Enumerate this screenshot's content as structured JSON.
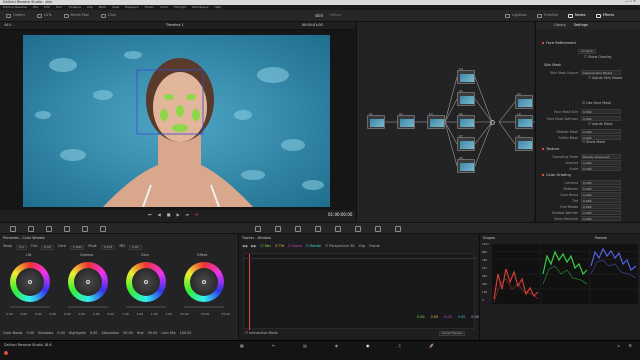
{
  "window": {
    "title": "DaVinci Resolve Studio - skin"
  },
  "menu": [
    "DaVinci Resolve",
    "File",
    "Edit",
    "Trim",
    "Timeline",
    "Clip",
    "Mark",
    "View",
    "Playback",
    "Fusion",
    "Color",
    "Fairlight",
    "Workspace",
    "Help"
  ],
  "topbar": {
    "left_buttons": [
      "Gallery",
      "LUTs",
      "Media Pool",
      "Clips"
    ],
    "project": "skin",
    "edited": "Edited",
    "right_buttons": [
      "Lightbox",
      "Timeline",
      "Nodes",
      "Effects",
      "Lightbox"
    ]
  },
  "viewerbar": {
    "zoom": "46%",
    "timeline": "Timeline 1",
    "timecode": "00:00:01:00",
    "clip_mode": "Clip"
  },
  "transport": {
    "timecode": "01:00:00:00"
  },
  "nodes": {
    "labels": [
      "01",
      "02",
      "03",
      "04",
      "05",
      "06",
      "07",
      "08",
      "09",
      "10",
      "11"
    ]
  },
  "inspector": {
    "tabs": [
      "Library",
      "Settings"
    ],
    "plugin": "Face Refinement",
    "analyze": "Analyze",
    "show_overlay": "Show Overlay",
    "skin_mask_title": "Skin Mask",
    "mask_source_label": "Skin Mask Source",
    "mask_source_value": "Internal Skin Model",
    "adjust_skin_model": "Adjust Skin Model",
    "use_face_mask": "Use Face Mask",
    "adjust_mask": "Adjust Mask",
    "show_mask": "Show Mask",
    "rows1": [
      {
        "label": "Face Mask Size",
        "value": "0.000"
      },
      {
        "label": "Face Mask Softness",
        "value": "0.000"
      }
    ],
    "rows2": [
      {
        "label": "Feather Mask",
        "value": "0.000"
      },
      {
        "label": "Soften Mask",
        "value": "0.000"
      }
    ],
    "texture_title": "Texture",
    "texture_rows": [
      {
        "label": "Operating Mode",
        "value": "Beauty Advanced"
      },
      {
        "label": "Amount",
        "value": "0.000"
      },
      {
        "label": "Scale",
        "value": "0.000"
      }
    ],
    "grading_title": "Color Grading",
    "grading_rows": [
      {
        "label": "Contrast",
        "value": "0.000"
      },
      {
        "label": "Midtones",
        "value": "0.000"
      },
      {
        "label": "Color Boost",
        "value": "0.000"
      },
      {
        "label": "Tint",
        "value": "0.000"
      },
      {
        "label": "Hue Rotate",
        "value": "0.000"
      },
      {
        "label": "Shadow Warmth",
        "value": "0.000"
      },
      {
        "label": "Shine Removal",
        "value": "0.000"
      }
    ]
  },
  "wheels": {
    "title": "Primaries - Color Wheels",
    "temp_label": "Temp",
    "temp_value": "0.0",
    "tint_label": "Tint",
    "tint_value": "0.00",
    "contrast_label": "Cont",
    "contrast_value": "1.000",
    "pivot_label": "Pivot",
    "pivot_value": "0.435",
    "md_label": "MD",
    "md_value": "0.00",
    "items": [
      {
        "name": "Lift",
        "values": [
          "0.00",
          "0.00",
          "0.00",
          "0.00"
        ]
      },
      {
        "name": "Gamma",
        "values": [
          "0.00",
          "0.00",
          "0.00",
          "0.00"
        ]
      },
      {
        "name": "Gain",
        "values": [
          "1.00",
          "1.00",
          "1.00",
          "1.00"
        ]
      },
      {
        "name": "Offset",
        "values": [
          "25.00",
          "25.00",
          "25.00"
        ]
      }
    ],
    "bottom": [
      {
        "label": "Color Boost",
        "value": "0.00"
      },
      {
        "label": "Shadows",
        "value": "0.00"
      },
      {
        "label": "Highlights",
        "value": "0.00"
      },
      {
        "label": "Saturation",
        "value": "50.00"
      },
      {
        "label": "Hue",
        "value": "50.00"
      },
      {
        "label": "Lum Mix",
        "value": "100.00"
      }
    ]
  },
  "tracker": {
    "title": "Tracker - Window",
    "checks": [
      "Pan",
      "Tilt",
      "Zoom",
      "Rotate",
      "Perspective 3D"
    ],
    "mode": "Clip",
    "frame": "Frame",
    "values": [
      "0.00",
      "0.00",
      "0.00",
      "0.00",
      "0.00"
    ],
    "bottom_left": "Interactive Mode",
    "bottom_right": "Cloud Tracker"
  },
  "scopes": {
    "title": "Scopes",
    "mode": "Parade",
    "ticks": [
      "1023",
      "896",
      "768",
      "512",
      "384",
      "256",
      "128",
      "0"
    ]
  },
  "taskbar": {
    "app": "DaVinci Resolve Studio 18.6"
  },
  "colors": {
    "accent_red": "#e04a3a",
    "node_border": "#6a6a6a",
    "scope_red": "#e8443a",
    "scope_green": "#3ee04a",
    "scope_blue": "#5a6aff"
  }
}
